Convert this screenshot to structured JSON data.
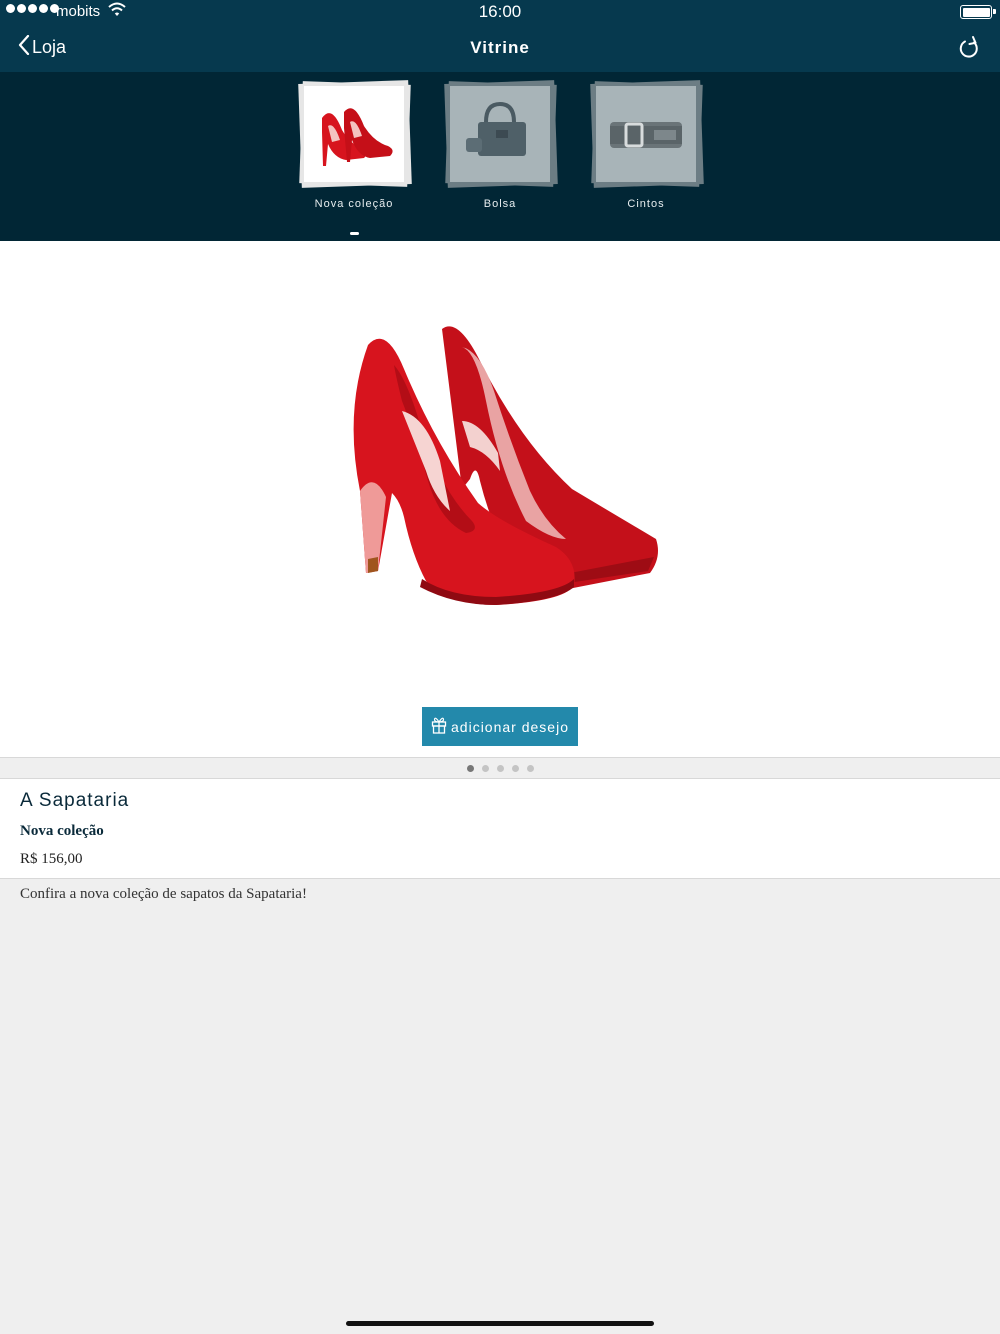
{
  "status": {
    "carrier": "mobits",
    "time": "16:00",
    "signal_dots": 5
  },
  "nav": {
    "back_label": "Loja",
    "title": "Vitrine",
    "back_icon": "chevron-left-icon",
    "refresh_icon": "refresh-icon"
  },
  "categories": [
    {
      "label": "Nova coleção",
      "icon": "red-heels-thumbnail",
      "active": true
    },
    {
      "label": "Bolsa",
      "icon": "handbag-thumbnail",
      "active": false
    },
    {
      "label": "Cintos",
      "icon": "belt-thumbnail",
      "active": false
    }
  ],
  "product": {
    "image": "red-high-heels-photo",
    "wish_button": "adicionar desejo",
    "wish_icon": "gift-icon",
    "store": "A Sapataria",
    "name": "Nova coleção",
    "price": "R$  156,00",
    "description": "Confira a nova coleção de sapatos da Sapataria!"
  },
  "pager": {
    "count": 5,
    "active_index": 0
  },
  "colors": {
    "navbar": "#06394e",
    "category_bar": "#012635",
    "wish_button": "#2389ab",
    "shoe_red": "#d7141e"
  }
}
